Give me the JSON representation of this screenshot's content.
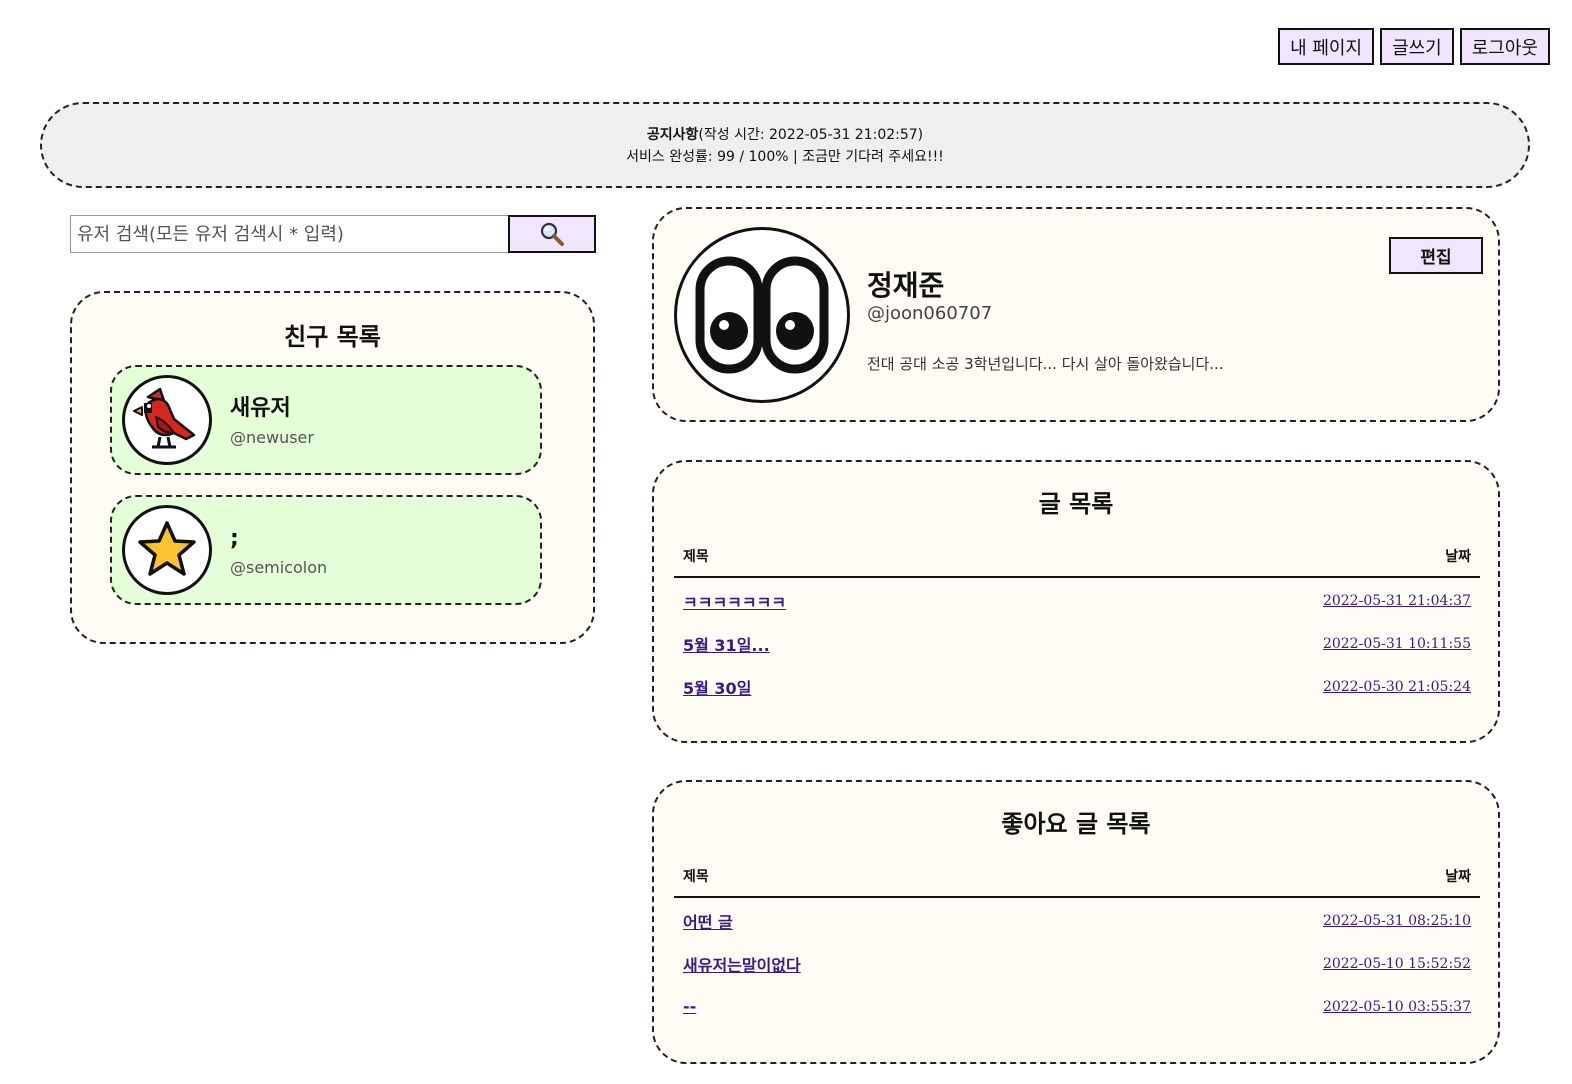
{
  "nav": {
    "my_page": "내 페이지",
    "write": "글쓰기",
    "logout": "로그아웃"
  },
  "notice": {
    "title": "공지사항",
    "time": "(작성 시간: 2022-05-31 21:02:57)",
    "body": "서비스 완성률: 99 / 100% | 조금만 기다려 주세요!!!"
  },
  "search": {
    "placeholder": "유저 검색(모든 유저 검색시 * 입력)",
    "icon": "search-icon"
  },
  "friends": {
    "title": "친구 목록",
    "items": [
      {
        "name": "새유저",
        "handle": "@newuser",
        "avatar": "cardinal-bird-icon"
      },
      {
        "name": ";",
        "handle": "@semicolon",
        "avatar": "star-icon"
      }
    ]
  },
  "profile": {
    "name": "정재준",
    "handle": "@joon060707",
    "bio": "전대 공대 소공 3학년입니다... 다시 살아 돌아왔습니다...",
    "edit_label": "편집",
    "avatar": "eyes-icon"
  },
  "posts": {
    "title": "글 목록",
    "col_title": "제목",
    "col_date": "날짜",
    "rows": [
      {
        "title": "ㅋㅋㅋㅋㅋㅋㅋ",
        "date": "2022-05-31 21:04:37"
      },
      {
        "title": "5월 31일...",
        "date": "2022-05-31 10:11:55"
      },
      {
        "title": "5월 30일",
        "date": "2022-05-30 21:05:24"
      }
    ]
  },
  "liked": {
    "title": "좋아요 글 목록",
    "col_title": "제목",
    "col_date": "날짜",
    "rows": [
      {
        "title": "어떤 글",
        "date": "2022-05-31 08:25:10"
      },
      {
        "title": "새유저는말이없다",
        "date": "2022-05-10 15:52:52"
      },
      {
        "title": "--",
        "date": "2022-05-10 03:55:37"
      }
    ]
  },
  "colors": {
    "button_bg": "#f1e6ff",
    "card_bg": "#fefcf4",
    "friend_bg": "#e4ffd8",
    "notice_bg": "#efeff0",
    "link": "#3a1a8a"
  }
}
